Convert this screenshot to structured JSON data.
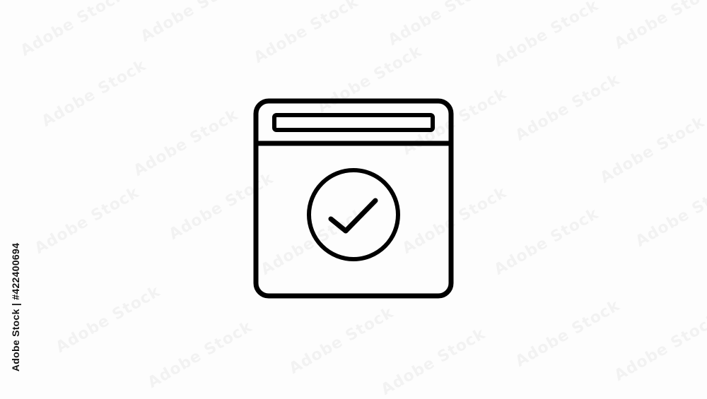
{
  "watermark": {
    "text": "Adobe Stock"
  },
  "stock_id": {
    "text": "Adobe Stock | #422400694"
  },
  "icon": {
    "name": "browser-window-check-icon",
    "stroke_color": "#000000",
    "background_color": "#fdfdfd"
  }
}
